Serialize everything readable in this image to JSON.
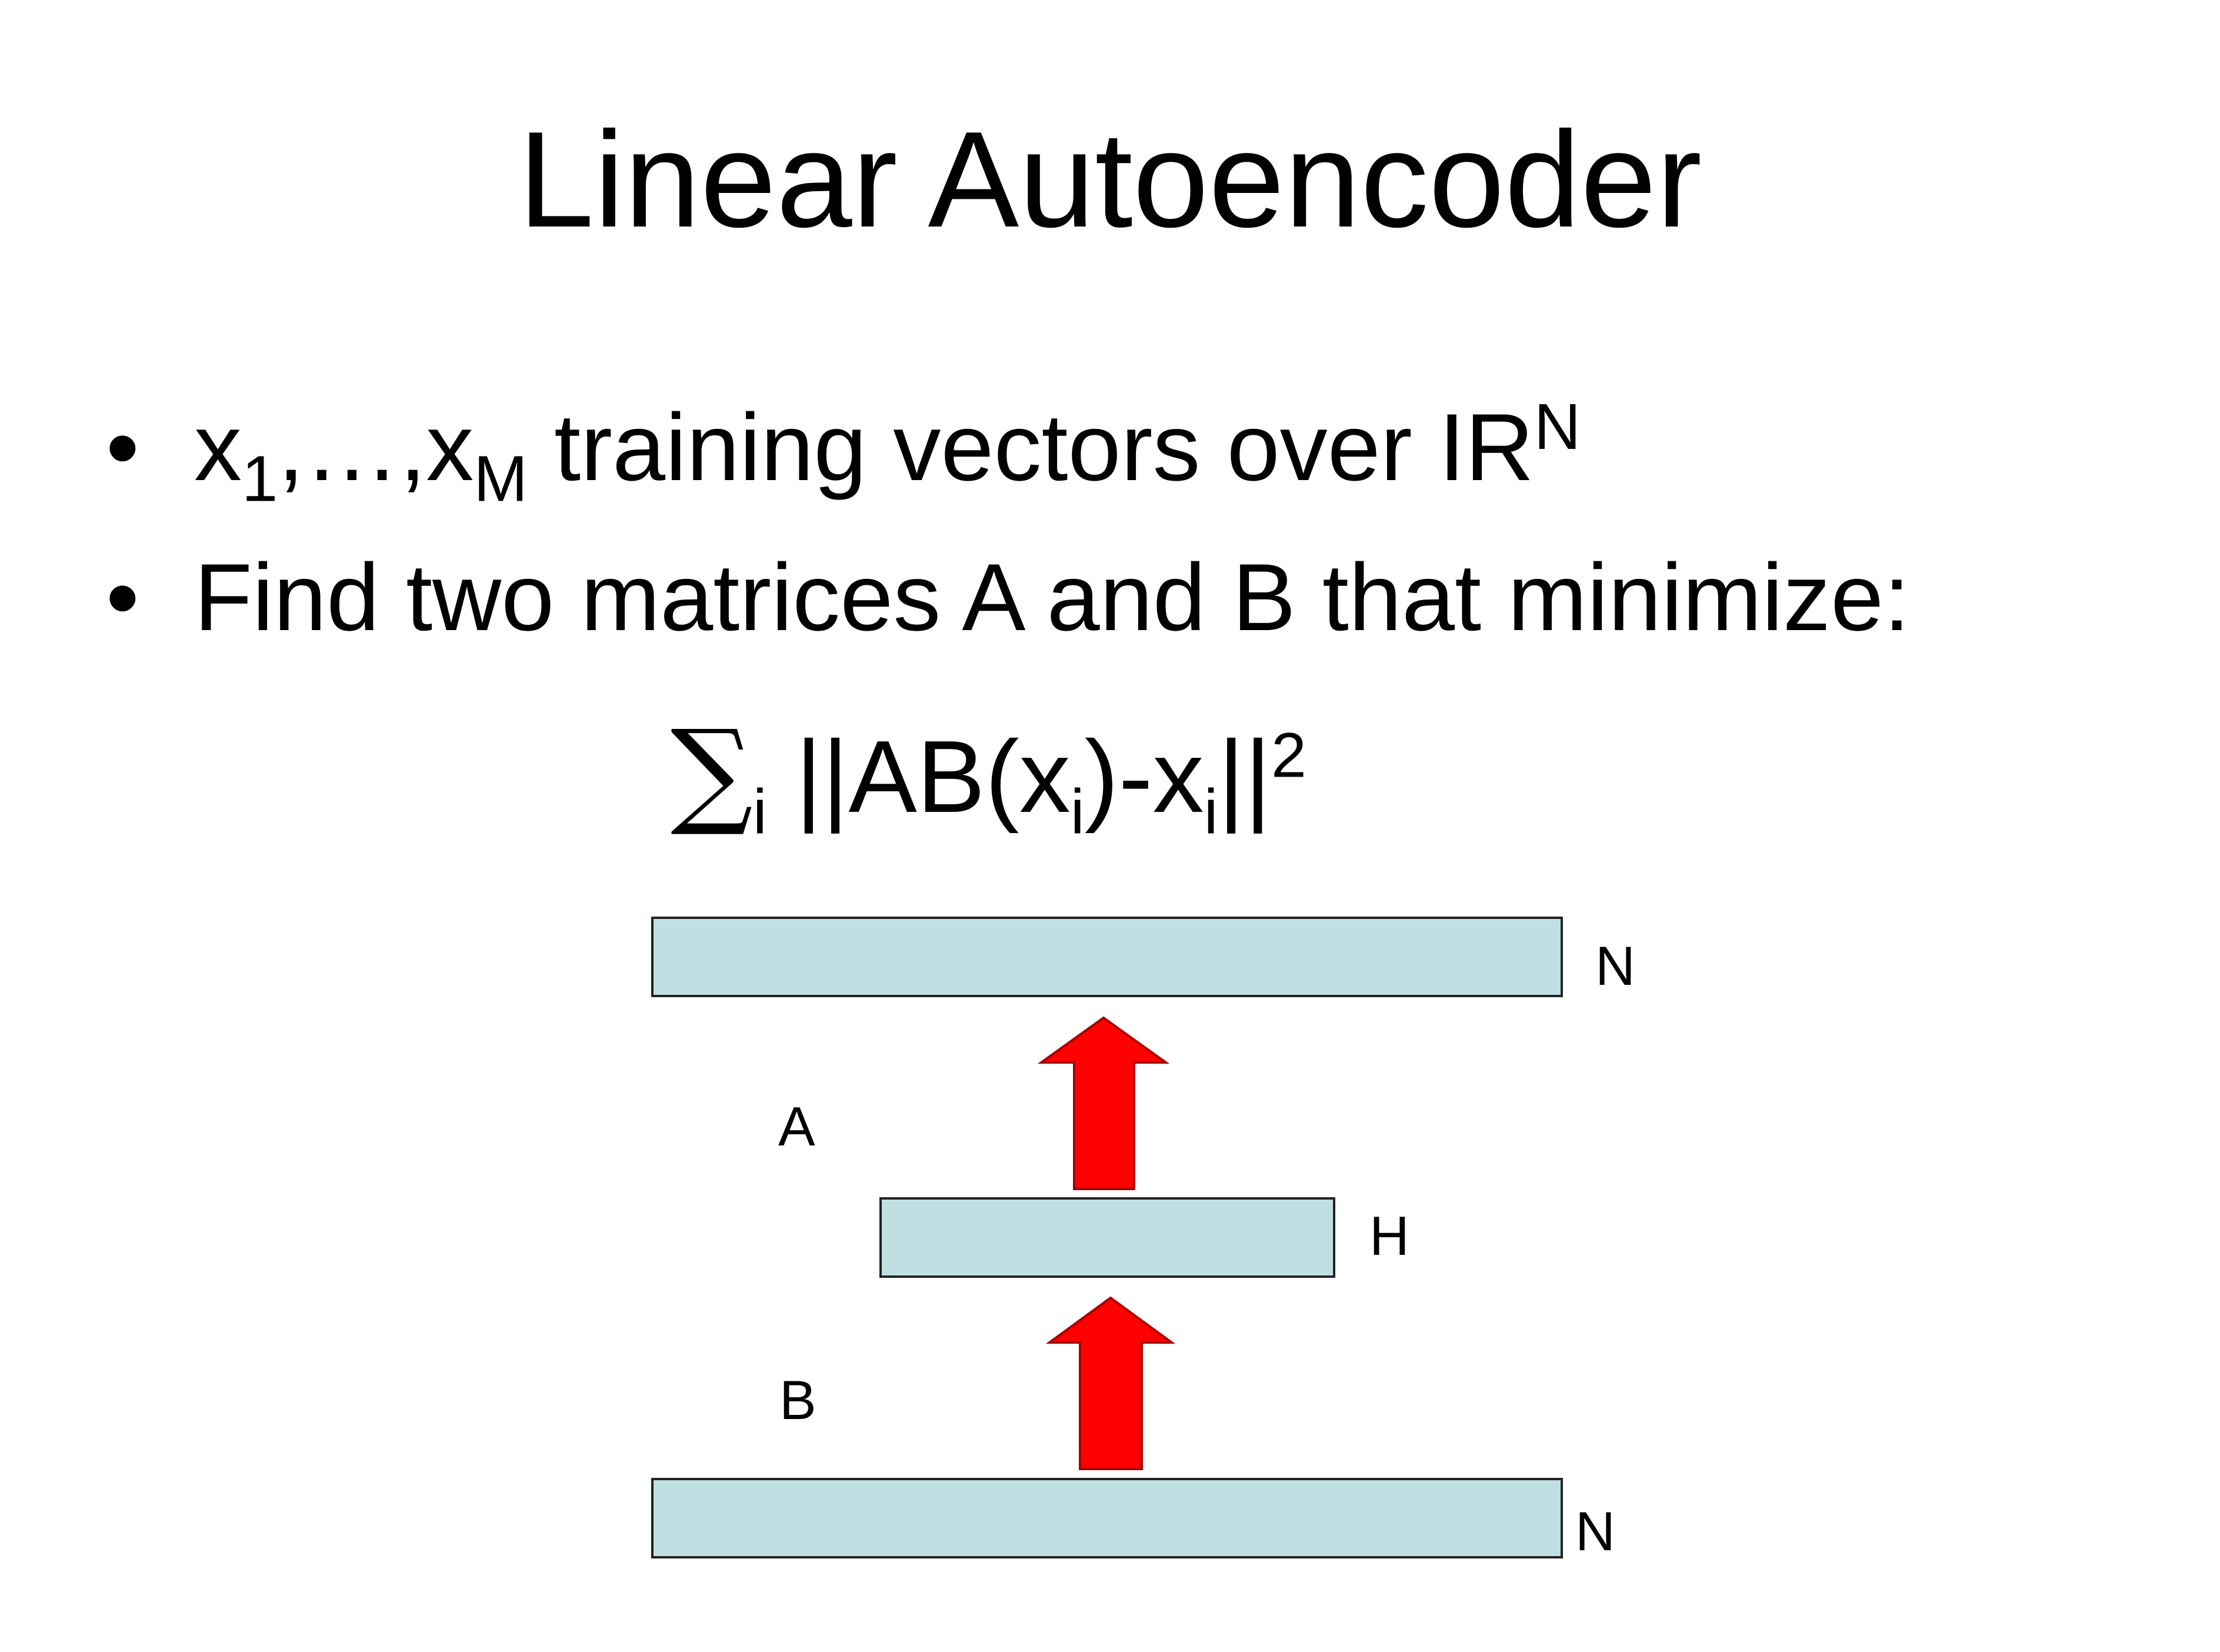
{
  "title": "Linear Autoencoder",
  "bullets": [
    {
      "var": "x",
      "sub_first": "1",
      "ellipsis": ",…,",
      "var2": "x",
      "sub_last": "M",
      "text": " training vectors over IR",
      "sup": "N"
    },
    {
      "text": "Find two matrices A and B that minimize:"
    }
  ],
  "bullet_glyph": "•",
  "formula": {
    "sigma": "∑",
    "sigma_sub": "i",
    "norm_open": " ||AB(x",
    "sub1": "i",
    "mid": ")-x",
    "sub2": "i",
    "norm_close": "||",
    "power": "2"
  },
  "diagram": {
    "colors": {
      "layer_fill": "#bfe0e3",
      "layer_stroke": "#222222",
      "arrow_fill": "#ff0000",
      "arrow_stroke": "#aa0000"
    },
    "layers": [
      {
        "label": "N",
        "role": "output"
      },
      {
        "label": "H",
        "role": "hidden"
      },
      {
        "label": "N",
        "role": "input"
      }
    ],
    "matrices": [
      {
        "label": "A"
      },
      {
        "label": "B"
      }
    ]
  }
}
